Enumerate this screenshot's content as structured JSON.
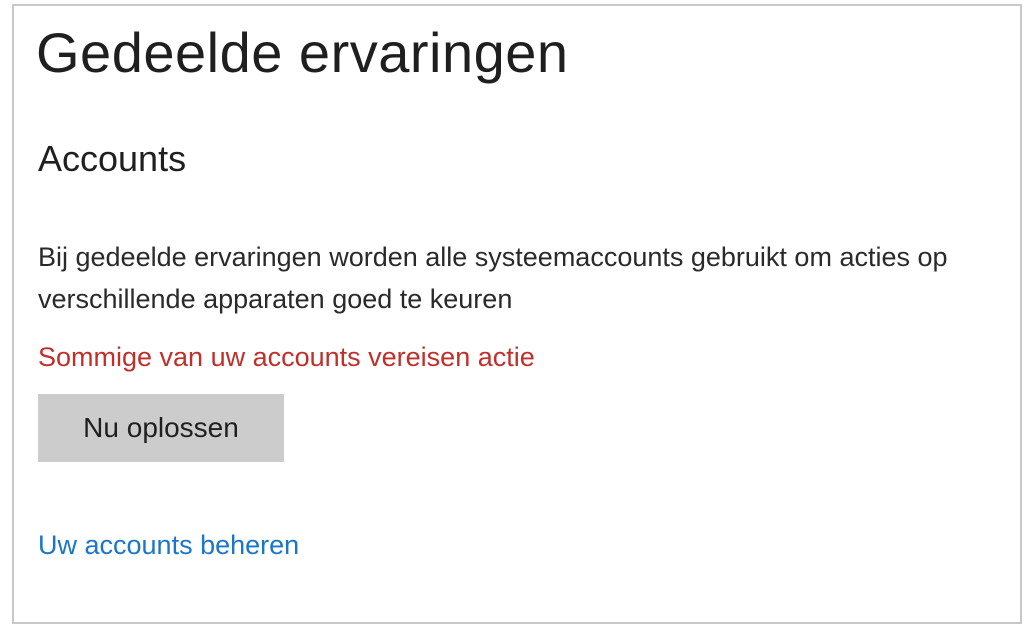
{
  "page": {
    "title": "Gedeelde ervaringen"
  },
  "accounts": {
    "heading": "Accounts",
    "description": "Bij gedeelde ervaringen worden alle systeemaccounts gebruikt om acties op verschillende apparaten goed te keuren",
    "warning": "Sommige van uw accounts vereisen actie",
    "fix_button_label": "Nu oplossen",
    "manage_link_label": "Uw accounts beheren"
  },
  "colors": {
    "warning": "#c0302b",
    "link": "#1a76c9",
    "button_bg": "#cccccc"
  }
}
